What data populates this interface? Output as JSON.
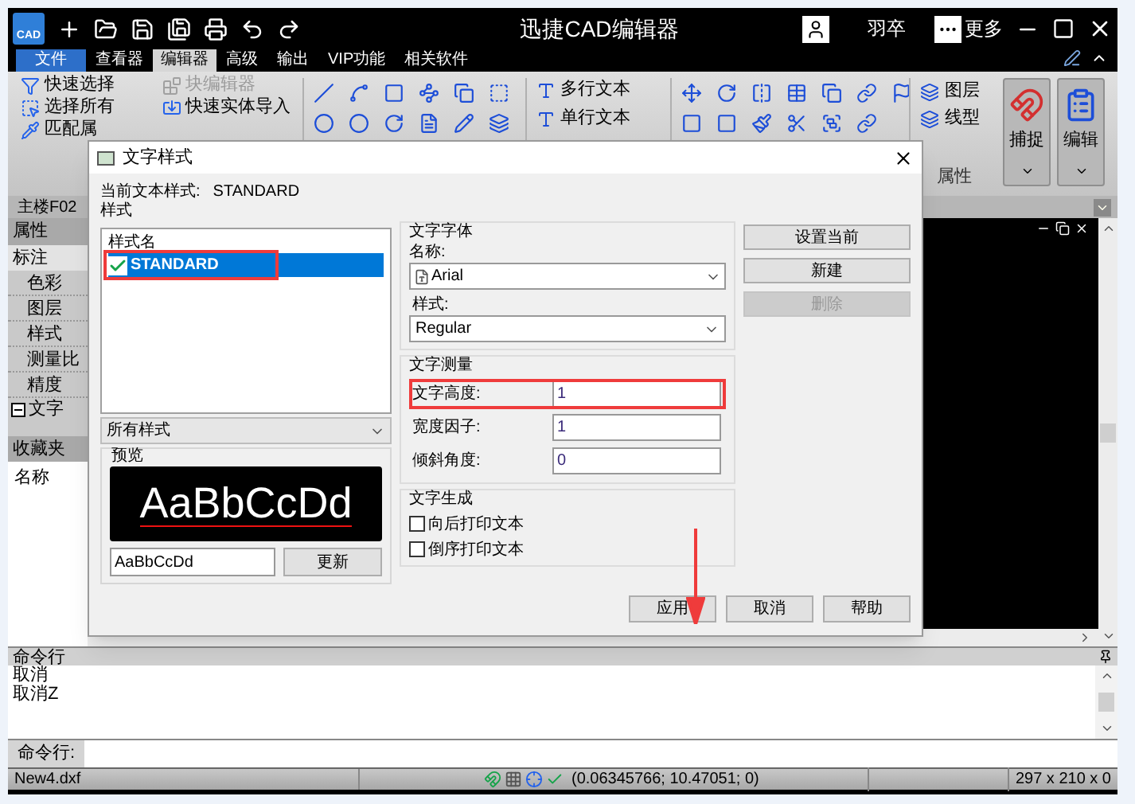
{
  "app": {
    "logo": "CAD",
    "title": "迅捷CAD编辑器",
    "user": "羽卒",
    "more": "更多"
  },
  "menu_tabs": [
    {
      "label": "文件",
      "selected": false,
      "kind": "file"
    },
    {
      "label": "查看器",
      "selected": false,
      "kind": "tab"
    },
    {
      "label": "编辑器",
      "selected": true,
      "kind": "tab"
    },
    {
      "label": "高级",
      "selected": false,
      "kind": "tab"
    },
    {
      "label": "输出",
      "selected": false,
      "kind": "tab"
    },
    {
      "label": "VIP功能",
      "selected": false,
      "kind": "tab"
    },
    {
      "label": "相关软件",
      "selected": false,
      "kind": "tab"
    }
  ],
  "ribbon": {
    "select_items": [
      {
        "label": "快速选择",
        "disabled": false
      },
      {
        "label": "块编辑器",
        "disabled": true
      },
      {
        "label": "选择所有",
        "disabled": false
      },
      {
        "label": "快速实体导入",
        "disabled": false
      },
      {
        "label": "匹配属",
        "disabled": false
      }
    ],
    "text_items": [
      "多行文本",
      "单行文本"
    ],
    "layer_items": [
      "图层",
      "线型"
    ],
    "group_label": "属性",
    "big_buttons": [
      "捕捉",
      "编辑"
    ]
  },
  "doc_tab": "主楼F02",
  "side_panel": {
    "header": "属性",
    "category": "标注",
    "items": [
      "色彩",
      "图层",
      "样式",
      "测量比",
      "精度"
    ],
    "section": {
      "label": "文字",
      "expanded": true
    },
    "favorites": "收藏夹",
    "name_label": "名称"
  },
  "dialog": {
    "title": "文字样式",
    "current_label": "当前文本样式:",
    "current_value": "STANDARD",
    "styles_label": "样式",
    "list_header": "样式名",
    "styles": [
      {
        "name": "STANDARD",
        "selected": true,
        "highlighted": true
      }
    ],
    "filter": "所有样式",
    "preview_label": "预览",
    "preview_text": "AaBbCcDd",
    "preview_input": "AaBbCcDd",
    "update": "更新",
    "font_group": "文字字体",
    "name_label": "名称:",
    "font": "Arial",
    "style_label": "样式:",
    "font_style": "Regular",
    "measure_group": "文字测量",
    "fields": [
      {
        "label": "文字高度:",
        "value": "1",
        "highlighted": true
      },
      {
        "label": "宽度因子:",
        "value": "1",
        "highlighted": false
      },
      {
        "label": "倾斜角度:",
        "value": "0",
        "highlighted": false
      }
    ],
    "gen_group": "文字生成",
    "options": [
      {
        "label": "向后打印文本",
        "checked": false
      },
      {
        "label": "倒序打印文本",
        "checked": false
      }
    ],
    "side_buttons": [
      {
        "label": "设置当前",
        "disabled": false
      },
      {
        "label": "新建",
        "disabled": false
      },
      {
        "label": "删除",
        "disabled": true
      }
    ],
    "footer_buttons": [
      "应用",
      "取消",
      "帮助"
    ]
  },
  "command": {
    "title": "命令行",
    "lines": [
      "取消",
      "取消Z"
    ],
    "prompt": "命令行:"
  },
  "status": {
    "file": "New4.dxf",
    "coords": "(0.06345766; 10.47051; 0)",
    "size": "297 x 210 x 0"
  }
}
